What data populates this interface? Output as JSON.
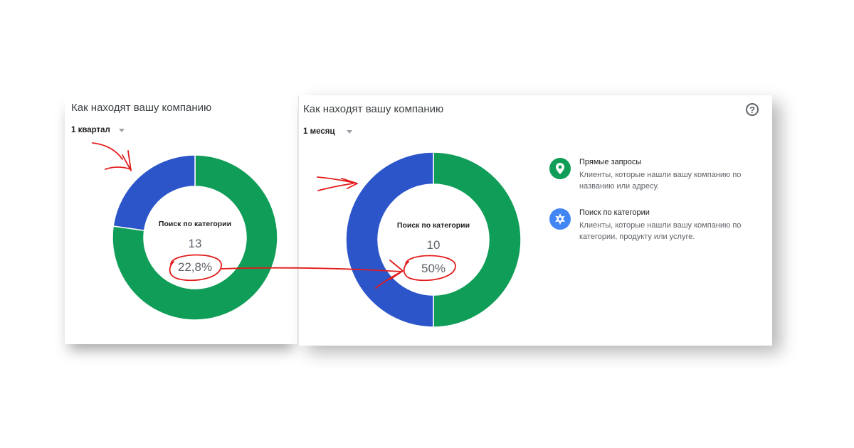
{
  "panels": [
    {
      "title": "Как находят вашу компанию",
      "period": "1 квартал",
      "center_label": "Поиск по категории",
      "center_count": "13",
      "center_percent": "22,8%"
    },
    {
      "title": "Как находят вашу компанию",
      "period": "1 месяц",
      "center_label": "Поиск по категории",
      "center_count": "10",
      "center_percent": "50%",
      "help_icon": "?"
    }
  ],
  "legend": [
    {
      "title": "Прямые запросы",
      "description": "Клиенты, которые нашли вашу компанию по названию или адресу.",
      "color": "#0f9d58",
      "icon": "map-pin-icon"
    },
    {
      "title": "Поиск по категории",
      "description": "Клиенты, которые нашли вашу компанию по категории, продукту или услуге.",
      "color": "#4285f4",
      "icon": "sparkle-icon"
    }
  ],
  "chart_data": [
    {
      "type": "pie",
      "variant": "donut",
      "categories": [
        "Прямые запросы",
        "Поиск по категории"
      ],
      "values": [
        77.2,
        22.8
      ],
      "colors": [
        "#0f9d58",
        "#2b55c9"
      ]
    },
    {
      "type": "pie",
      "variant": "donut",
      "categories": [
        "Прямые запросы",
        "Поиск по категории"
      ],
      "values": [
        50,
        50
      ],
      "colors": [
        "#0f9d58",
        "#2b55c9"
      ]
    }
  ],
  "annotation_color": "#e31b1b"
}
